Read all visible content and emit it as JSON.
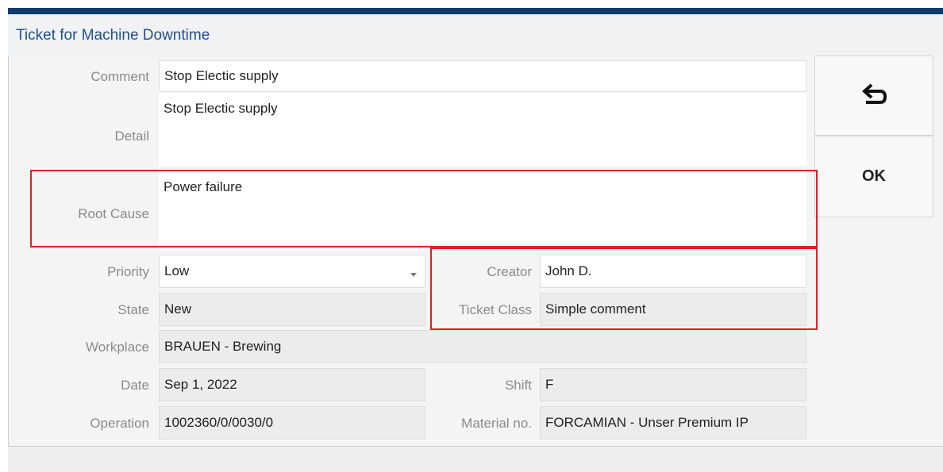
{
  "window": {
    "title": "Ticket for Machine Downtime"
  },
  "form": {
    "comment": {
      "label": "Comment",
      "value": "Stop Electic supply"
    },
    "detail": {
      "label": "Detail",
      "value": "Stop Electic supply"
    },
    "root_cause": {
      "label": "Root Cause",
      "value": "Power failure"
    },
    "priority": {
      "label": "Priority",
      "value": "Low"
    },
    "state": {
      "label": "State",
      "value": "New"
    },
    "workplace": {
      "label": "Workplace",
      "value": "BRAUEN - Brewing"
    },
    "date": {
      "label": "Date",
      "value": "Sep 1, 2022"
    },
    "operation": {
      "label": "Operation",
      "value": "1002360/0/0030/0"
    },
    "creator": {
      "label": "Creator",
      "value": "John D."
    },
    "ticket_class": {
      "label": "Ticket Class",
      "value": "Simple comment"
    },
    "shift": {
      "label": "Shift",
      "value": "F"
    },
    "material_no": {
      "label": "Material no.",
      "value": "FORCAMIAN - Unser Premium IP"
    }
  },
  "actions": {
    "back_icon": "undo-arrow-icon",
    "ok_label": "OK"
  },
  "colors": {
    "title_text": "#1f4f8f",
    "top_bar": "#0e3c6e",
    "highlight": "#e02020"
  }
}
